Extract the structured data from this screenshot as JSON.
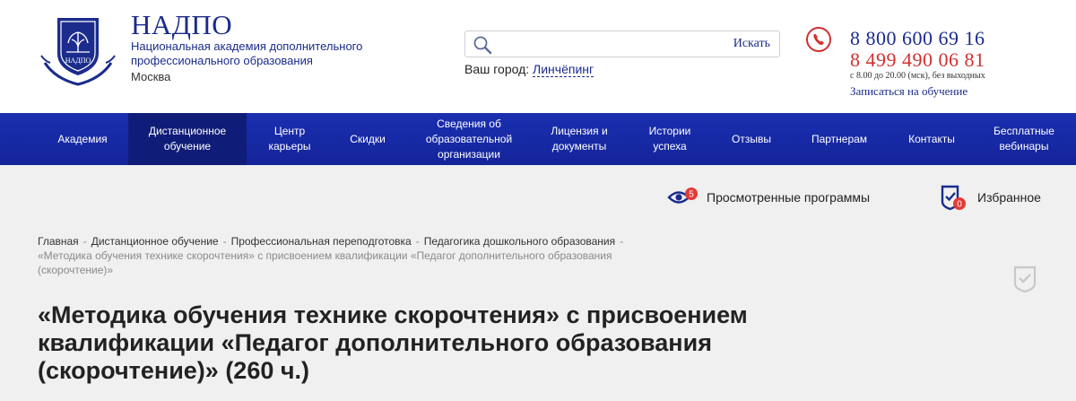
{
  "header": {
    "brand_title": "НАДПО",
    "brand_subtitle": "Национальная академия дополнительного профессионального образования",
    "brand_city": "Москва",
    "logo_text": "НАДПО",
    "search": {
      "placeholder": "",
      "button_label": "Искать"
    },
    "city": {
      "label": "Ваш город:",
      "value": "Линчёпинг"
    },
    "contacts": {
      "phone_1": "8 800 600 69 16",
      "phone_2": "8 499 490 06 81",
      "hours": "с 8.00 до 20.00 (мск), без выходных",
      "enroll_link": "Записаться на обучение"
    }
  },
  "nav": {
    "items": [
      {
        "label": "Академия"
      },
      {
        "label": "Дистанционное обучение"
      },
      {
        "label": "Центр карьеры"
      },
      {
        "label": "Скидки"
      },
      {
        "label": "Сведения об образовательной организации"
      },
      {
        "label": "Лицензия и документы"
      },
      {
        "label": "Истории успеха"
      },
      {
        "label": "Отзывы"
      },
      {
        "label": "Партнерам"
      },
      {
        "label": "Контакты"
      },
      {
        "label": "Бесплатные вебинары"
      }
    ],
    "active_index": 1
  },
  "toolbar": {
    "viewed_label": "Просмотренные программы",
    "viewed_count": "5",
    "favorites_label": "Избранное",
    "favorites_count": "0"
  },
  "breadcrumbs": {
    "items": [
      "Главная",
      "Дистанционное обучение",
      "Профессиональная переподготовка",
      "Педагогика дошкольного образования"
    ],
    "current": "«Методика обучения технике скорочтения» с присвоением квалификации «Педагог дополнительного образования (скорочтение)»"
  },
  "page": {
    "title": "«Методика обучения технике скорочтения» с присвоением квалификации «Педагог дополнительного образования (скорочтение)» (260 ч.)"
  },
  "colors": {
    "brand_blue": "#1b2c8c",
    "nav_blue": "#1a2fb0",
    "nav_active": "#101d78",
    "accent_red": "#d32f2f",
    "page_bg": "#f0f0f0"
  }
}
